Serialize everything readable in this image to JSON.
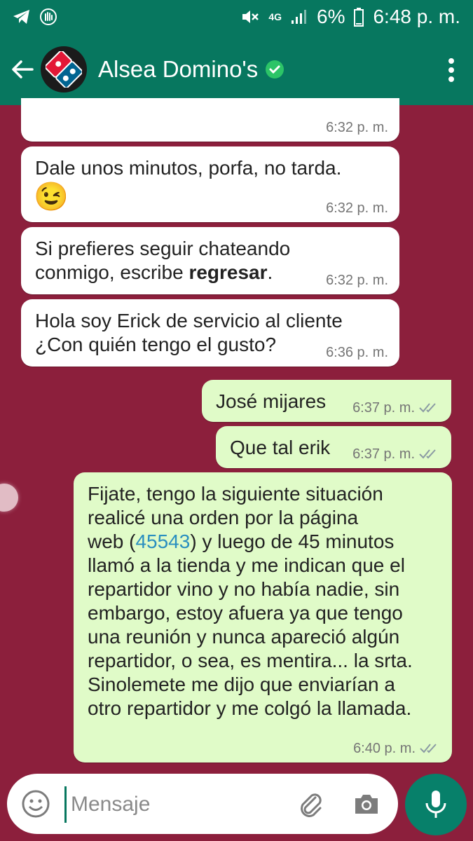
{
  "status_bar": {
    "network": "4G",
    "battery": "6%",
    "time": "6:48 p. m."
  },
  "header": {
    "contact_name": "Alsea Domino's"
  },
  "messages": [
    {
      "direction": "in",
      "text": "",
      "time": "6:32 p. m."
    },
    {
      "direction": "in",
      "text": "Dale unos minutos, porfa, no tarda.",
      "emoji": "😉",
      "time": "6:32 p. m."
    },
    {
      "direction": "in",
      "text_line1": "Si prefieres seguir chateando",
      "text_line2_prefix": "conmigo, escribe ",
      "text_bold": "regresar",
      "text_suffix": ".",
      "time": "6:32 p. m."
    },
    {
      "direction": "in",
      "text_line1": "Hola soy Erick de servicio al cliente",
      "text_line2": "¿Con quién tengo el gusto?",
      "time": "6:36 p. m."
    },
    {
      "direction": "out",
      "text": "José mijares",
      "time": "6:37 p. m."
    },
    {
      "direction": "out",
      "text": "Que tal erik",
      "time": "6:37 p. m."
    },
    {
      "direction": "out",
      "line1": "Fijate,  tengo la siguiente situación",
      "line2": "realicé una orden por la página",
      "line3_prefix": "web  (",
      "link": "45543",
      "line3_suffix": ") y luego de 45 minutos",
      "line4": "llamó a la tienda y me indican que el",
      "line5": "repartidor vino y no había nadie, sin",
      "line6": "embargo, estoy afuera ya que tengo",
      "line7": "una reunión y nunca apareció algún",
      "line8": "repartidor,  o sea, es mentira... la srta.",
      "line9": "Sinolemete me dijo que enviarían a",
      "line10": "otro repartidor y me colgó la llamada.",
      "time": "6:40 p. m."
    }
  ],
  "composer": {
    "placeholder": "Mensaje"
  },
  "colors": {
    "header": "#07775f",
    "chat_background": "#8c1f3c",
    "outgoing_bubble": "#e0fbc8",
    "incoming_bubble": "#ffffff",
    "link": "#2a8fc0"
  }
}
